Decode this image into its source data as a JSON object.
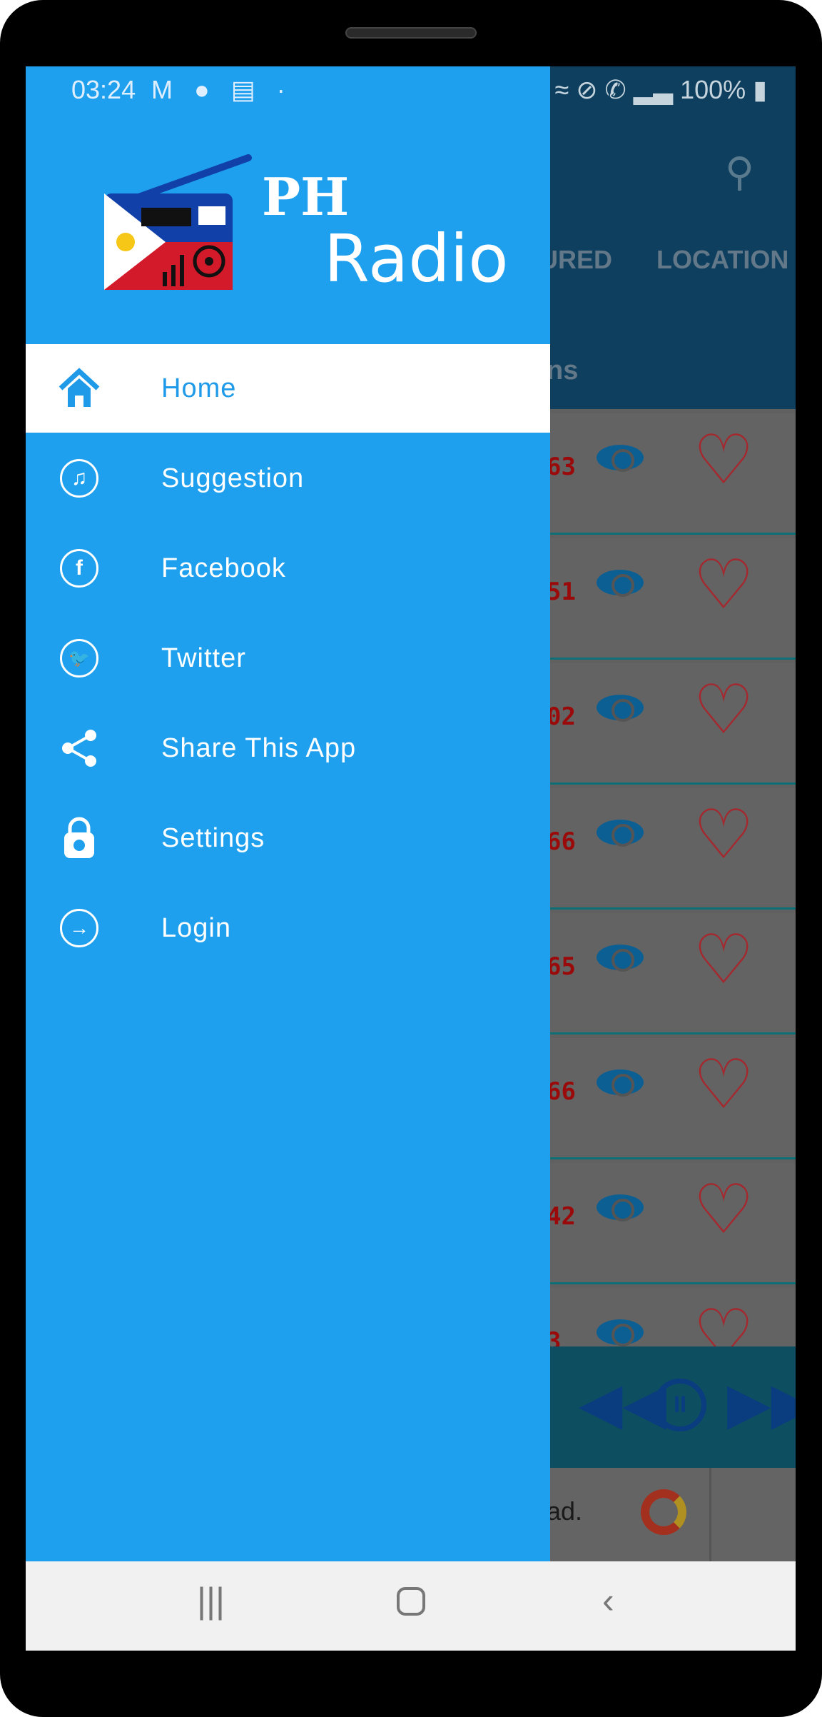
{
  "status_bar": {
    "time": "03:24",
    "left_icons": [
      "gmail-icon",
      "messenger-icon",
      "radio-icon",
      "dot"
    ],
    "battery": "100%"
  },
  "background_app": {
    "tabs": [
      "URED",
      "LOCATION"
    ],
    "subheader": "ns",
    "rows": [
      "63",
      "51",
      "02",
      "66",
      "65",
      "66",
      "42",
      "3"
    ],
    "ad_text": "ad."
  },
  "drawer": {
    "logo": {
      "line1": "PH",
      "line2": "Radio",
      "badge": "PH RADIO"
    },
    "items": [
      {
        "label": "Home",
        "icon": "home-icon",
        "active": true
      },
      {
        "label": "Suggestion",
        "icon": "music-add-icon"
      },
      {
        "label": "Facebook",
        "icon": "facebook-icon"
      },
      {
        "label": "Twitter",
        "icon": "twitter-icon"
      },
      {
        "label": "Share This App",
        "icon": "share-icon"
      },
      {
        "label": "Settings",
        "icon": "lock-gear-icon"
      },
      {
        "label": "Login",
        "icon": "login-icon"
      }
    ]
  },
  "colors": {
    "drawer": "#1ea0ef",
    "active_text": "#1e9ae8",
    "scrim_appbar": "#0e3f5e"
  }
}
